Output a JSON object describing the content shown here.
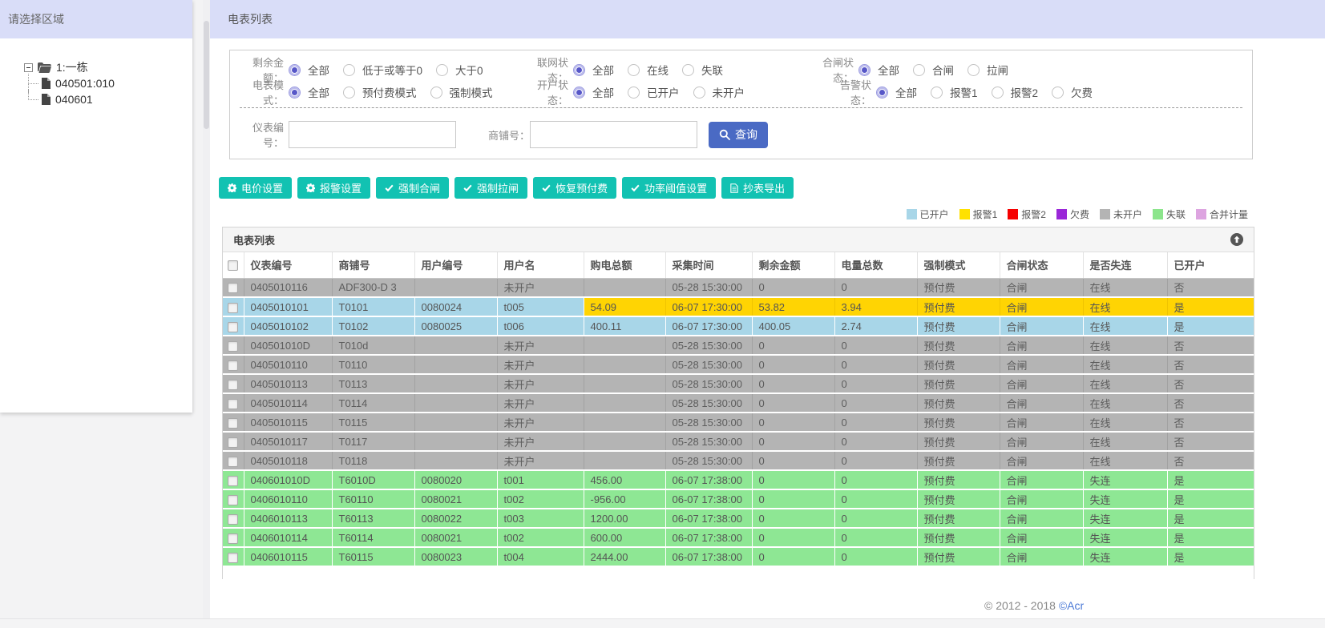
{
  "colors": {
    "header_bar": "#d9ddf8",
    "action_teal": "#12c2b2",
    "query_blue": "#4a6ac4",
    "row_gray": "#b4b4b4",
    "row_blue": "#a8d6e8",
    "row_green": "#8ee794",
    "alert_yellow": "#ffd403"
  },
  "sidebar": {
    "title": "请选择区域",
    "tree": {
      "root": "1:一栋",
      "root_icons": [
        "minus-box-icon",
        "folder-icon"
      ],
      "children": [
        "040501:010",
        "040601"
      ],
      "child_icon": "file-icon"
    }
  },
  "header": {
    "title": "电表列表"
  },
  "filters": {
    "rows": [
      [
        {
          "label": "剩余金额：",
          "options": [
            "全部",
            "低于或等于0",
            "大于0"
          ],
          "selected": 0
        },
        {
          "label": "联网状态：",
          "options": [
            "全部",
            "在线",
            "失联"
          ],
          "selected": 0
        },
        {
          "label": "合闸状态：",
          "options": [
            "全部",
            "合闸",
            "拉闸"
          ],
          "selected": 0
        }
      ],
      [
        {
          "label": "电表模式：",
          "options": [
            "全部",
            "预付费模式",
            "强制模式"
          ],
          "selected": 0
        },
        {
          "label": "开户状态：",
          "options": [
            "全部",
            "已开户",
            "未开户"
          ],
          "selected": 0
        },
        {
          "label": "告警状态：",
          "options": [
            "全部",
            "报警1",
            "报警2",
            "欠费"
          ],
          "selected": 0
        }
      ]
    ],
    "search": {
      "meter_no_label": "仪表编号：",
      "meter_no_value": "",
      "shop_no_label": "商铺号：",
      "shop_no_value": "",
      "query_label": "查询",
      "query_icon": "search-icon"
    }
  },
  "actions": [
    {
      "icon": "gear",
      "label": "电价设置"
    },
    {
      "icon": "gear",
      "label": "报警设置"
    },
    {
      "icon": "check",
      "label": "强制合闸"
    },
    {
      "icon": "check",
      "label": "强制拉闸"
    },
    {
      "icon": "check",
      "label": "恢复预付费"
    },
    {
      "icon": "check",
      "label": "功率阈值设置"
    },
    {
      "icon": "file",
      "label": "抄表导出"
    }
  ],
  "legend": [
    {
      "label": "已开户",
      "color": "#a8d6e8"
    },
    {
      "label": "报警1",
      "color": "#ffe100"
    },
    {
      "label": "报警2",
      "color": "#f60000"
    },
    {
      "label": "欠费",
      "color": "#9a27d8"
    },
    {
      "label": "未开户",
      "color": "#b4b4b4"
    },
    {
      "label": "失联",
      "color": "#8ce58c"
    },
    {
      "label": "合并计量",
      "color": "#dda4e0"
    }
  ],
  "table": {
    "panel_title": "电表列表",
    "collapse_icon": "up-circle-icon",
    "columns": [
      "仪表编号",
      "商铺号",
      "用户编号",
      "用户名",
      "购电总额",
      "采集时间",
      "剩余金额",
      "电量总数",
      "强制模式",
      "合闸状态",
      "是否失连",
      "已开户"
    ],
    "rows": [
      {
        "state": "gray",
        "cells": [
          "0405010116",
          "ADF300-D 3",
          "",
          "未开户",
          "",
          "05-28 15:30:00",
          "0",
          "0",
          "预付费",
          "合闸",
          "在线",
          "否"
        ]
      },
      {
        "state": "blue",
        "alert_from": 4,
        "cells": [
          "0405010101",
          "T0101",
          "0080024",
          "t005",
          "54.09",
          "06-07 17:30:00",
          "53.82",
          "3.94",
          "预付费",
          "合闸",
          "在线",
          "是"
        ]
      },
      {
        "state": "blue",
        "cells": [
          "0405010102",
          "T0102",
          "0080025",
          "t006",
          "400.11",
          "06-07 17:30:00",
          "400.05",
          "2.74",
          "预付费",
          "合闸",
          "在线",
          "是"
        ]
      },
      {
        "state": "gray",
        "cells": [
          "040501010D",
          "T010d",
          "",
          "未开户",
          "",
          "05-28 15:30:00",
          "0",
          "0",
          "预付费",
          "合闸",
          "在线",
          "否"
        ]
      },
      {
        "state": "gray",
        "cells": [
          "0405010110",
          "T0110",
          "",
          "未开户",
          "",
          "05-28 15:30:00",
          "0",
          "0",
          "预付费",
          "合闸",
          "在线",
          "否"
        ]
      },
      {
        "state": "gray",
        "cells": [
          "0405010113",
          "T0113",
          "",
          "未开户",
          "",
          "05-28 15:30:00",
          "0",
          "0",
          "预付费",
          "合闸",
          "在线",
          "否"
        ]
      },
      {
        "state": "gray",
        "cells": [
          "0405010114",
          "T0114",
          "",
          "未开户",
          "",
          "05-28 15:30:00",
          "0",
          "0",
          "预付费",
          "合闸",
          "在线",
          "否"
        ]
      },
      {
        "state": "gray",
        "cells": [
          "0405010115",
          "T0115",
          "",
          "未开户",
          "",
          "05-28 15:30:00",
          "0",
          "0",
          "预付费",
          "合闸",
          "在线",
          "否"
        ]
      },
      {
        "state": "gray",
        "cells": [
          "0405010117",
          "T0117",
          "",
          "未开户",
          "",
          "05-28 15:30:00",
          "0",
          "0",
          "预付费",
          "合闸",
          "在线",
          "否"
        ]
      },
      {
        "state": "gray",
        "cells": [
          "0405010118",
          "T0118",
          "",
          "未开户",
          "",
          "05-28 15:30:00",
          "0",
          "0",
          "预付费",
          "合闸",
          "在线",
          "否"
        ]
      },
      {
        "state": "green",
        "cells": [
          "040601010D",
          "T6010D",
          "0080020",
          "t001",
          "456.00",
          "06-07 17:38:00",
          "0",
          "0",
          "预付费",
          "合闸",
          "失连",
          "是"
        ]
      },
      {
        "state": "green",
        "cells": [
          "0406010110",
          "T60110",
          "0080021",
          "t002",
          "-956.00",
          "06-07 17:38:00",
          "0",
          "0",
          "预付费",
          "合闸",
          "失连",
          "是"
        ]
      },
      {
        "state": "green",
        "cells": [
          "0406010113",
          "T60113",
          "0080022",
          "t003",
          "1200.00",
          "06-07 17:38:00",
          "0",
          "0",
          "预付费",
          "合闸",
          "失连",
          "是"
        ]
      },
      {
        "state": "green",
        "cells": [
          "0406010114",
          "T60114",
          "0080021",
          "t002",
          "600.00",
          "06-07 17:38:00",
          "0",
          "0",
          "预付费",
          "合闸",
          "失连",
          "是"
        ]
      },
      {
        "state": "green",
        "cells": [
          "0406010115",
          "T60115",
          "0080023",
          "t004",
          "2444.00",
          "06-07 17:38:00",
          "0",
          "0",
          "预付费",
          "合闸",
          "失连",
          "是"
        ]
      }
    ]
  },
  "footer": {
    "copyright": "© 2012 - 2018",
    "link_text": "©Acr"
  }
}
